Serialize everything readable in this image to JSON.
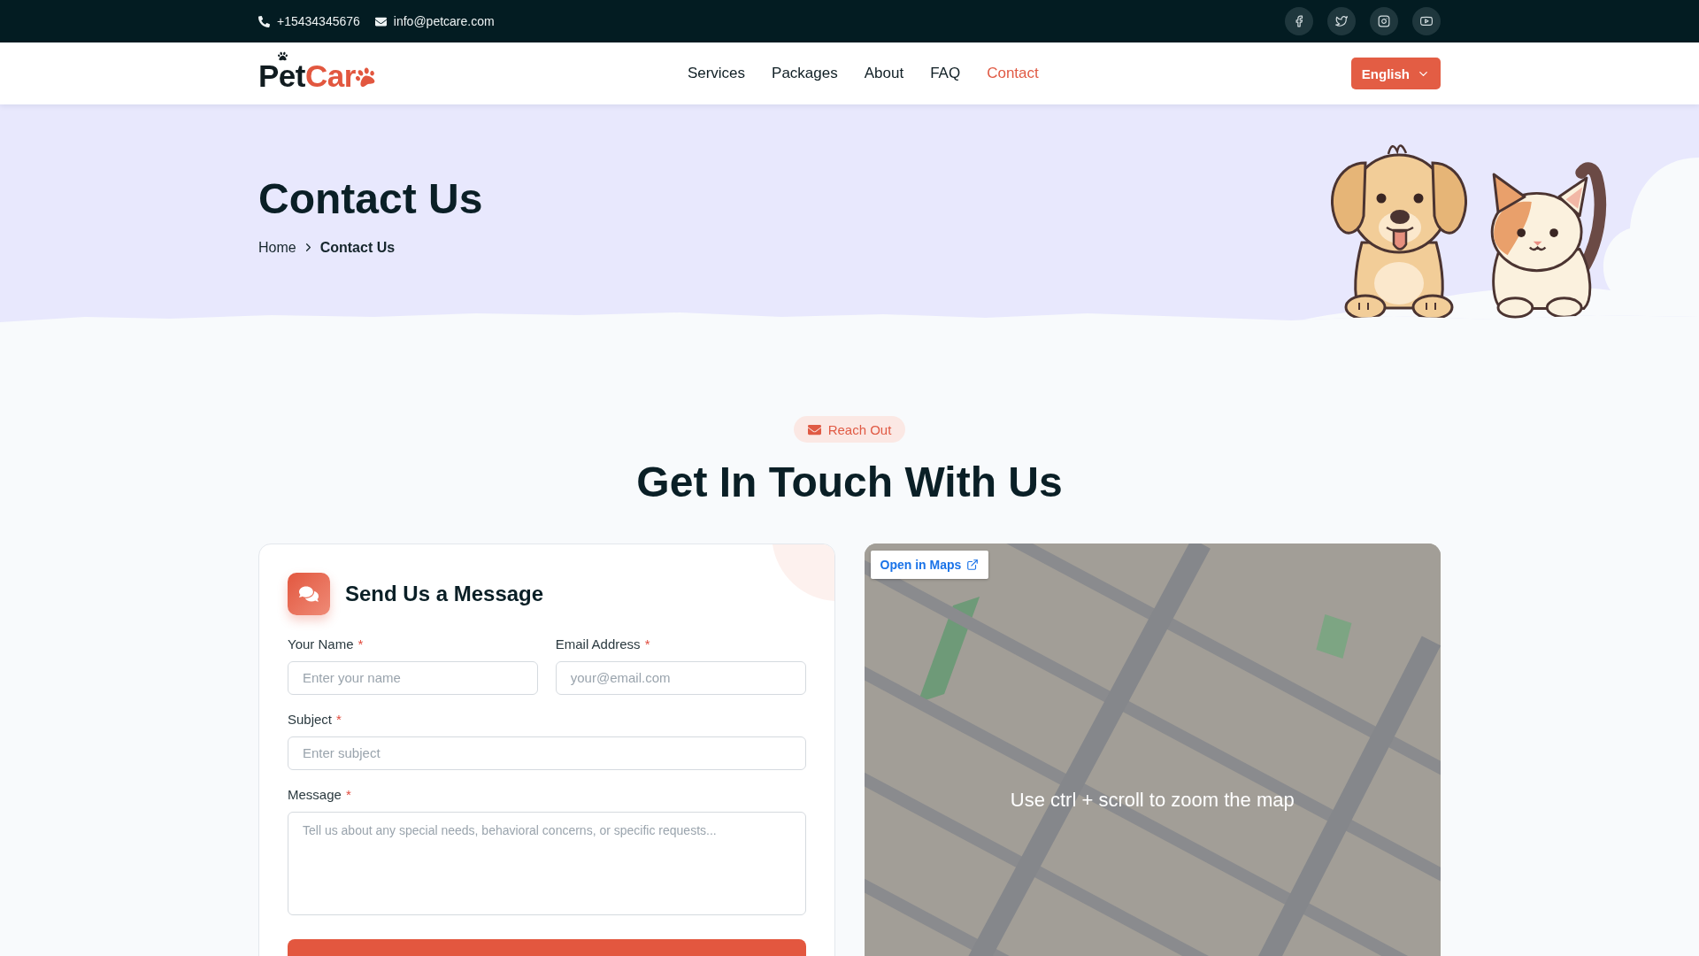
{
  "top_bar": {
    "phone": "+15434345676",
    "email": "info@petcare.com",
    "social_links": [
      {
        "kind": "facebook"
      },
      {
        "kind": "twitter"
      },
      {
        "kind": "instagram"
      },
      {
        "kind": "youtube"
      }
    ]
  },
  "header": {
    "logo": {
      "text": "Pet",
      "accent_text": "Car"
    },
    "nav": [
      {
        "label": "Services",
        "selected": false
      },
      {
        "label": "Packages",
        "selected": false
      },
      {
        "label": "About",
        "selected": false
      },
      {
        "label": "FAQ",
        "selected": false
      },
      {
        "label": "Contact",
        "selected": true
      }
    ],
    "language": "English"
  },
  "hero": {
    "title": "Contact Us",
    "breadcrumb": [
      {
        "label": "Home",
        "current": false
      },
      {
        "label": "Contact Us",
        "current": true
      }
    ]
  },
  "section": {
    "badge": "Reach Out",
    "title": "Get In Touch With Us"
  },
  "form": {
    "title": "Send Us a Message",
    "rows": [
      [
        {
          "kind": "text",
          "label": "Your Name",
          "required_mark": "*",
          "placeholder": "Enter your name"
        },
        {
          "kind": "email",
          "label": "Email Address",
          "required_mark": "*",
          "placeholder": "your@email.com"
        }
      ],
      [
        {
          "kind": "text",
          "label": "Subject",
          "required_mark": "*",
          "placeholder": "Enter subject"
        }
      ],
      [
        {
          "kind": "textarea",
          "label": "Message",
          "required_mark": "*",
          "placeholder": "Tell us about any special needs, behavioral concerns, or specific requests..."
        }
      ]
    ]
  },
  "map": {
    "open_link": "Open in Maps",
    "hint": "Use ctrl + scroll to zoom the map"
  }
}
